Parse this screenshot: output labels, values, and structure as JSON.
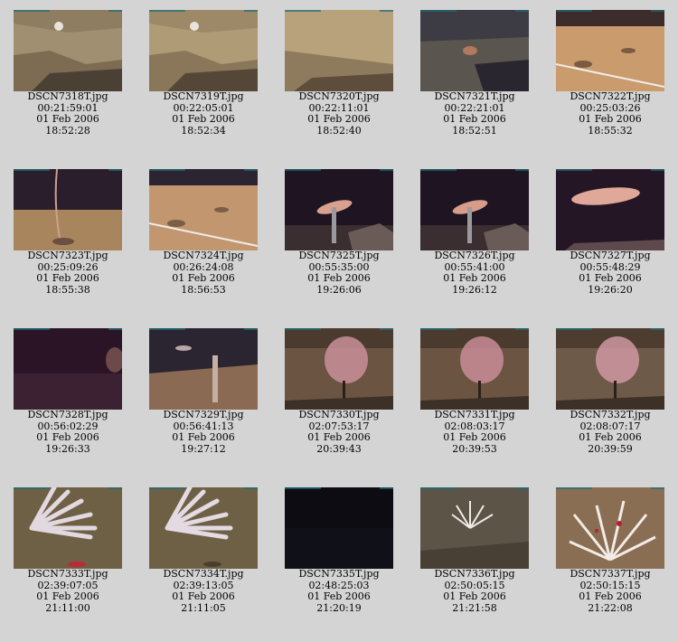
{
  "thumbnails": [
    {
      "file": "DSCN7318T.jpg",
      "elapsed": "00:21:59:01",
      "date": "01 Feb 2006",
      "time": "18:52:28",
      "scene": "rock-wall-sponge",
      "palette": [
        "#a08f70",
        "#7d6b52",
        "#4a4034"
      ]
    },
    {
      "file": "DSCN7319T.jpg",
      "elapsed": "00:22:05:01",
      "date": "01 Feb 2006",
      "time": "18:52:34",
      "scene": "rock-wall-sponge",
      "palette": [
        "#b09b77",
        "#8a7658",
        "#544738"
      ]
    },
    {
      "file": "DSCN7320T.jpg",
      "elapsed": "00:22:11:01",
      "date": "01 Feb 2006",
      "time": "18:52:40",
      "scene": "rock-ledge",
      "palette": [
        "#b8a27c",
        "#8e7a5c",
        "#5e4d3b"
      ]
    },
    {
      "file": "DSCN7321T.jpg",
      "elapsed": "00:22:21:01",
      "date": "01 Feb 2006",
      "time": "18:52:51",
      "scene": "dark-rocks",
      "palette": [
        "#3d3c44",
        "#5a564f",
        "#2a2630"
      ]
    },
    {
      "file": "DSCN7322T.jpg",
      "elapsed": "00:25:03:26",
      "date": "01 Feb 2006",
      "time": "18:55:32",
      "scene": "sand-rope",
      "palette": [
        "#c99b6d",
        "#3c2c2c",
        "#7b5a42"
      ]
    },
    {
      "file": "DSCN7323T.jpg",
      "elapsed": "00:25:09:26",
      "date": "01 Feb 2006",
      "time": "18:55:38",
      "scene": "sand-whip",
      "palette": [
        "#a9855d",
        "#2a1e2c",
        "#6a5040"
      ]
    },
    {
      "file": "DSCN7324T.jpg",
      "elapsed": "00:26:24:08",
      "date": "01 Feb 2006",
      "time": "18:56:53",
      "scene": "sand-rope",
      "palette": [
        "#c29770",
        "#2c2430",
        "#7a5e46"
      ]
    },
    {
      "file": "DSCN7325T.jpg",
      "elapsed": "00:55:35:00",
      "date": "01 Feb 2006",
      "time": "19:26:06",
      "scene": "fish-gear",
      "palette": [
        "#1e1422",
        "#d9a08e",
        "#6a5a58"
      ]
    },
    {
      "file": "DSCN7326T.jpg",
      "elapsed": "00:55:41:00",
      "date": "01 Feb 2006",
      "time": "19:26:12",
      "scene": "fish-gear",
      "palette": [
        "#1e1422",
        "#d89c8a",
        "#6a5a58"
      ]
    },
    {
      "file": "DSCN7327T.jpg",
      "elapsed": "00:55:48:29",
      "date": "01 Feb 2006",
      "time": "19:26:20",
      "scene": "fish-large",
      "palette": [
        "#251626",
        "#dfa898",
        "#5e4a4c"
      ]
    },
    {
      "file": "DSCN7328T.jpg",
      "elapsed": "00:56:02:29",
      "date": "01 Feb 2006",
      "time": "19:26:33",
      "scene": "dark-water",
      "palette": [
        "#2a1426",
        "#3c2132",
        "#6d4a4a"
      ]
    },
    {
      "file": "DSCN7329T.jpg",
      "elapsed": "00:56:41:13",
      "date": "01 Feb 2006",
      "time": "19:27:12",
      "scene": "pole-gear",
      "palette": [
        "#2a2530",
        "#8a6a52",
        "#c4b0a2"
      ]
    },
    {
      "file": "DSCN7330T.jpg",
      "elapsed": "02:07:53:17",
      "date": "01 Feb 2006",
      "time": "20:39:43",
      "scene": "coral-pink",
      "palette": [
        "#6b5442",
        "#c9909a",
        "#3d3026"
      ]
    },
    {
      "file": "DSCN7331T.jpg",
      "elapsed": "02:08:03:17",
      "date": "01 Feb 2006",
      "time": "20:39:53",
      "scene": "coral-pink",
      "palette": [
        "#6b5442",
        "#c98c96",
        "#3d3026"
      ]
    },
    {
      "file": "DSCN7332T.jpg",
      "elapsed": "02:08:07:17",
      "date": "01 Feb 2006",
      "time": "20:39:59",
      "scene": "coral-pink",
      "palette": [
        "#6e5a48",
        "#cf98a2",
        "#3d3026"
      ]
    },
    {
      "file": "DSCN7333T.jpg",
      "elapsed": "02:39:07:05",
      "date": "01 Feb 2006",
      "time": "21:11:00",
      "scene": "fan-white",
      "palette": [
        "#6e6044",
        "#e2d8e0",
        "#c2263a"
      ]
    },
    {
      "file": "DSCN7334T.jpg",
      "elapsed": "02:39:13:05",
      "date": "01 Feb 2006",
      "time": "21:11:05",
      "scene": "fan-white",
      "palette": [
        "#6e6044",
        "#e4dae2",
        "#4a3e2e"
      ]
    },
    {
      "file": "DSCN7335T.jpg",
      "elapsed": "02:48:25:03",
      "date": "01 Feb 2006",
      "time": "21:20:19",
      "scene": "black",
      "palette": [
        "#0c0c12",
        "#141420",
        "#0a0a10"
      ]
    },
    {
      "file": "DSCN7336T.jpg",
      "elapsed": "02:50:05:15",
      "date": "01 Feb 2006",
      "time": "21:21:58",
      "scene": "coral-white-small",
      "palette": [
        "#5c5446",
        "#eeeae8",
        "#3a342a"
      ]
    },
    {
      "file": "DSCN7337T.jpg",
      "elapsed": "02:50:15:15",
      "date": "01 Feb 2006",
      "time": "21:22:08",
      "scene": "coral-white-big",
      "palette": [
        "#8a6e54",
        "#f2ece6",
        "#b52030"
      ]
    }
  ]
}
